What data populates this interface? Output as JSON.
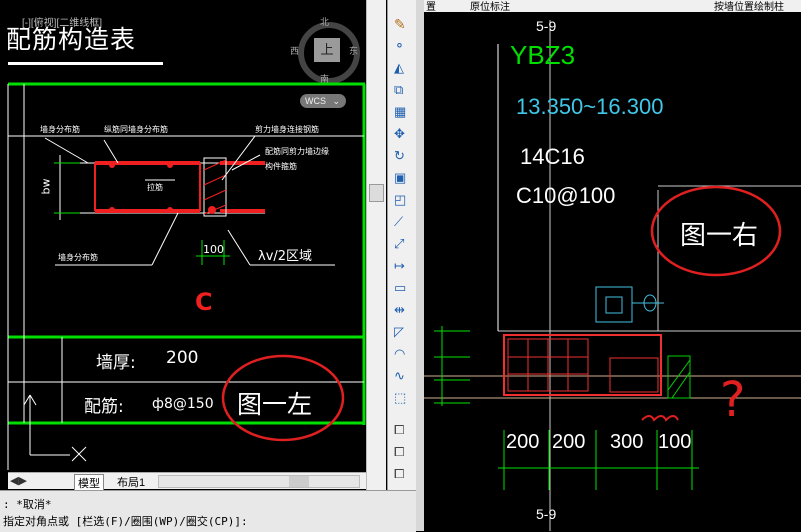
{
  "left_pane": {
    "title": "配筋构造表",
    "title_overlay": "[-][俯视][二维线框]",
    "compass": {
      "north": "北",
      "south": "南",
      "east": "东",
      "west": "西",
      "center": "上"
    },
    "wcs_label": "WCS",
    "annotations": {
      "a1": "墙身分布筋",
      "a2": "纵筋同墙身分布筋",
      "a3": "剪力墙身连接钢筋",
      "a4": "配筋同剪力墙边缘",
      "a5": "构件箍筋",
      "a6": "拉筋",
      "a7": "墙身分布筋",
      "bw": "bw",
      "dim100": "100",
      "zone": "λv/2区域",
      "c": "C"
    },
    "wall_thickness_label": "墙厚:",
    "wall_thickness_value": "200",
    "rebar_label": "配筋:",
    "rebar_value": "ф8@150",
    "handwritten": "图一左",
    "tabs": [
      "模型",
      "布局1"
    ]
  },
  "command_line": {
    "line1": ": *取消*",
    "line2": "指定对角点或 [栏选(F)/圈围(WP)/圈交(CP)]:"
  },
  "toolbar": {
    "icons": [
      "pencil-icon",
      "circles-icon",
      "triangle-icon",
      "layers-icon",
      "grid-icon",
      "move-icon",
      "rotate-icon",
      "box-icon",
      "copy-icon",
      "line-icon",
      "dim-icon",
      "arrow-icon",
      "rect-icon",
      "measure-icon",
      "polygon-icon",
      "arc-icon",
      "spline-icon",
      "cube-icon",
      "stack-icon-1",
      "stack-icon-2",
      "stack-icon-3"
    ]
  },
  "right_pane": {
    "header_left": "置",
    "header_mid": "原位标注",
    "header_right": "按墙位置绘制柱",
    "axis_top": "5-9",
    "axis_bottom": "5-9",
    "column_id": "YBZ3",
    "elevation": "13.350~16.300",
    "long_rebar": "14C16",
    "stirrup": "C10@100",
    "handwritten": "图一右",
    "question": "?",
    "dims": [
      "200",
      "200",
      "300",
      "100"
    ]
  }
}
